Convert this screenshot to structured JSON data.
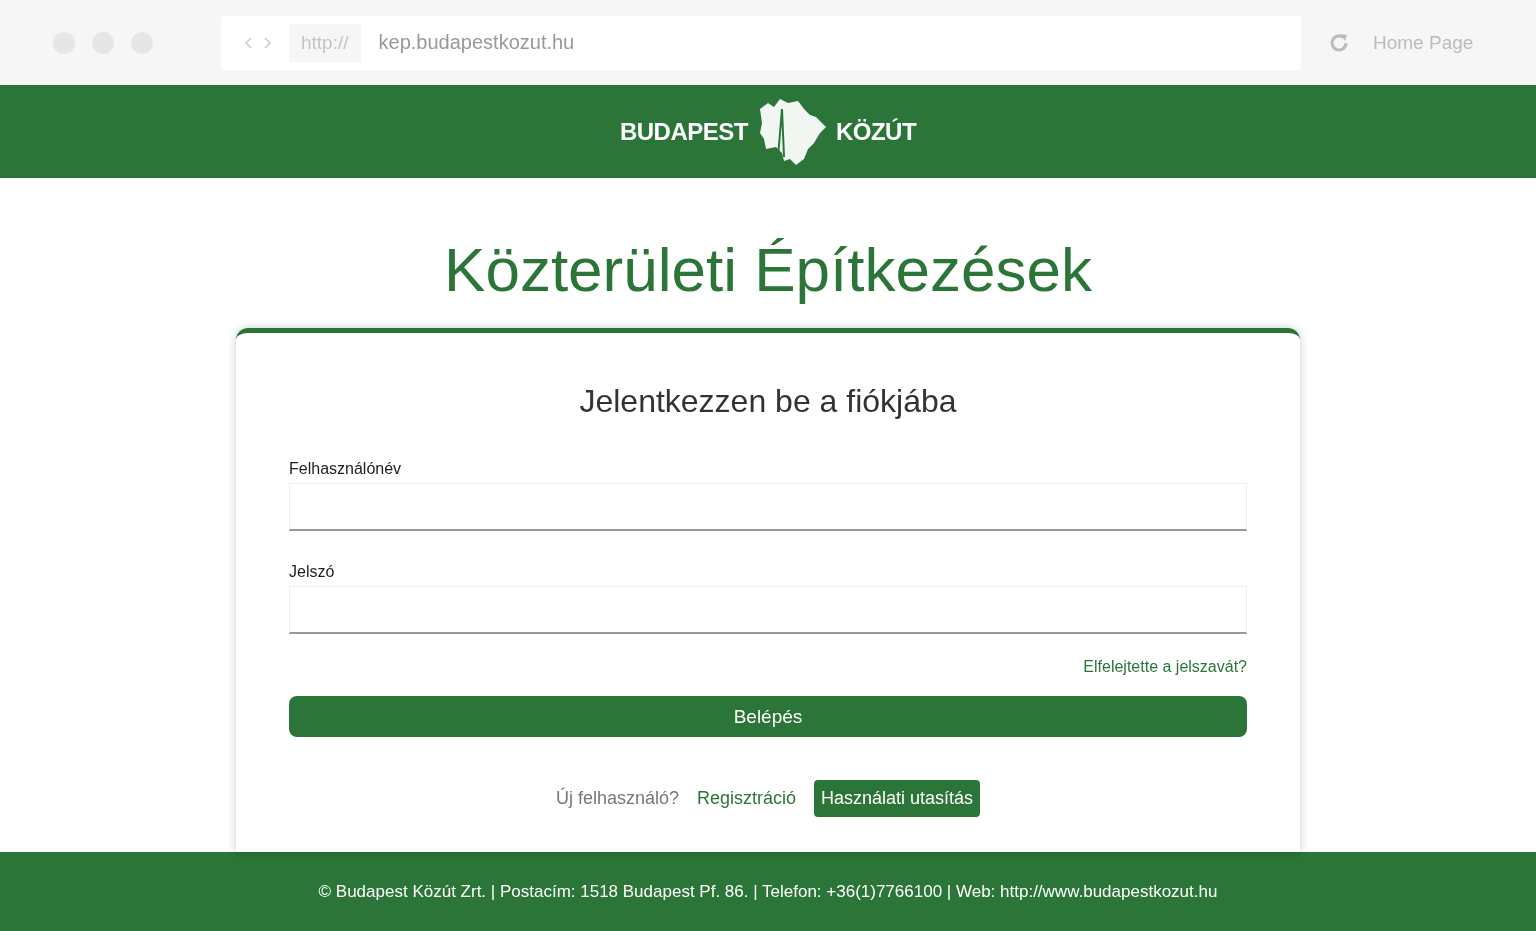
{
  "browser": {
    "scheme": "http://",
    "url": "kep.budapestkozut.hu",
    "home": "Home Page"
  },
  "header": {
    "logo_left": "BUDAPEST",
    "logo_right": "KÖZÚT"
  },
  "title": "Közterületi Építkezések",
  "login": {
    "heading": "Jelentkezzen be a fiókjába",
    "fields": [
      {
        "label": "Felhasználónév"
      },
      {
        "label": "Jelszó"
      }
    ],
    "forgot": "Elfelejtette a jelszavát?",
    "submit": "Belépés",
    "new_user": "Új felhasználó?",
    "register": "Regisztráció",
    "manual": "Használati utasítás"
  },
  "footer": "© Budapest Közút Zrt. | Postacím: 1518 Budapest Pf. 86. | Telefon: +36(1)7766100 | Web: http://www.budapestkozut.hu"
}
